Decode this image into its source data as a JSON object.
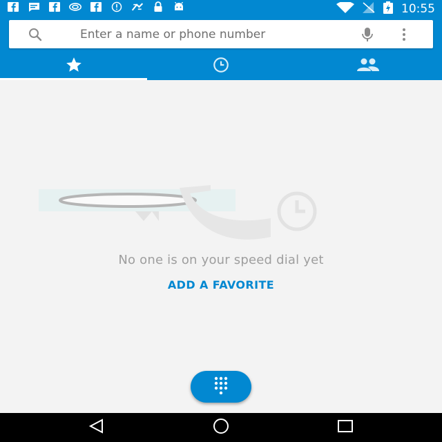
{
  "status_bar": {
    "time": "10:55",
    "left_icons": [
      "facebook-icon",
      "message-icon",
      "facebook-icon",
      "nvidia-icon",
      "facebook-icon",
      "alert-circle-icon",
      "fast-app-icon",
      "lock-icon",
      "android-icon"
    ],
    "right_icons": [
      "wifi-icon",
      "signal-off-icon",
      "battery-charging-icon"
    ]
  },
  "search": {
    "placeholder": "Enter a name or phone number",
    "value": ""
  },
  "tabs": [
    {
      "icon": "star-icon",
      "selected": true
    },
    {
      "icon": "clock-icon",
      "selected": false
    },
    {
      "icon": "people-icon",
      "selected": false
    }
  ],
  "empty_state": {
    "message": "No one is on your speed dial yet",
    "action_label": "ADD A FAVORITE"
  },
  "fab": {
    "icon": "dialpad-icon"
  },
  "nav": {
    "icons": [
      "back-icon",
      "home-icon",
      "recents-icon"
    ]
  },
  "colors": {
    "primary": "#0288d1",
    "background": "#f3f3f3",
    "empty_text": "#9e9e9e",
    "nav_bar": "#000000"
  }
}
